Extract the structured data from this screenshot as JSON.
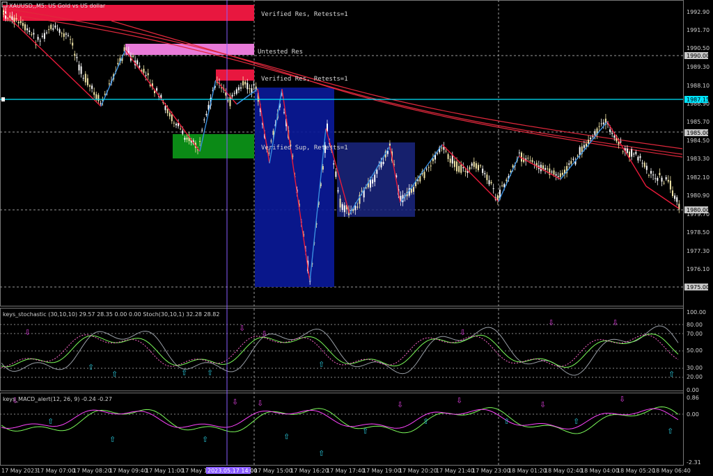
{
  "window": {
    "title": "XAUUSD,,M5: US Gold vs US dollar"
  },
  "colors": {
    "background": "#000000",
    "grid": "#5a5a5a",
    "bull_candle": "#f2e6a8",
    "bear_candle": "#ffffff",
    "zigzag_down": "#e81a3a",
    "zigzag_up": "#3a8fe0",
    "ma_line": "#e0283c",
    "current_price_line": "#00e5ff",
    "verified_res_zone": "#e8173f",
    "untested_res_zone": "#e87ad8",
    "verified_sup_zone": "#0b8a16",
    "stoch_main": "#9aa0a8",
    "stoch_signal": "#7cfc5a",
    "macd_main": "#7cfc5a",
    "macd_signal": "#ff44ff",
    "arrow_up": "#27c6d8",
    "arrow_down": "#e040e0"
  },
  "main_chart": {
    "price_scale": [
      "1992.90",
      "1991.70",
      "1990.50",
      "1989.30",
      "1988.10",
      "1986.90",
      "1985.70",
      "1984.50",
      "1983.30",
      "1982.10",
      "1980.90",
      "1979.70",
      "1978.50",
      "1977.30",
      "1976.10"
    ],
    "price_labels": [
      {
        "text": "1990.00",
        "price": 1990.0
      },
      {
        "text": "1987.15",
        "price": 1987.15,
        "highlight": true
      },
      {
        "text": "1985.00",
        "price": 1985.0
      },
      {
        "text": "1980.00",
        "price": 1980.0
      },
      {
        "text": "1975.00",
        "price": 1975.0
      }
    ],
    "zone_labels": [
      {
        "text": "Verified Res, Retests=1"
      },
      {
        "text": "Untested Res"
      },
      {
        "text": "Verified Res, Retests=1"
      },
      {
        "text": "Verified Sup, Retests=1"
      }
    ],
    "ylim": [
      1974.3,
      1993.6
    ]
  },
  "stochastic": {
    "label": "keys_stochastic (30,10,10) 29.57 28.35 0.00 0.00 Stoch(30,10,1) 32.28 28.82",
    "scale": [
      "100.00",
      "80.00",
      "70.00",
      "50.00",
      "30.00",
      "20.00",
      "0.00"
    ]
  },
  "macd": {
    "label": "keys_MACD_alert(12, 26, 9) -0.24 -0.27",
    "scale": [
      "0.86",
      "0.00",
      "-2.31"
    ]
  },
  "time_axis": {
    "labels": [
      "17 May 2023",
      "17 May 07:00",
      "17 May 08:20",
      "17 May 09:40",
      "17 May 11:00",
      "17 May 1",
      "17 May 15:00",
      "17 May 16:20",
      "17 May 17:40",
      "17 May 19:00",
      "17 May 20:20",
      "17 May 21:40",
      "17 May 23:00",
      "18 May 01:20",
      "18 May 02:40",
      "18 May 04:00",
      "18 May 05:20",
      "18 May 06:40"
    ],
    "cursor_label": "2023.05.17 14:00"
  }
}
